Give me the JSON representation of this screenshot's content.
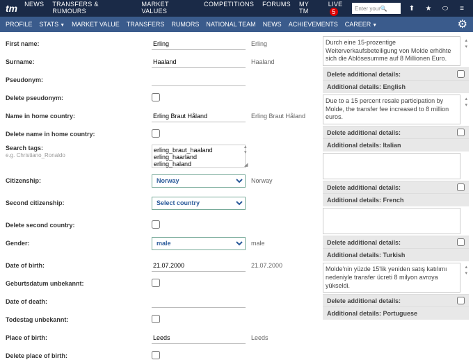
{
  "topnav": {
    "logo": "tm",
    "items": [
      "NEWS",
      "TRANSFERS & RUMOURS",
      "MARKET VALUES",
      "COMPETITIONS",
      "FORUMS",
      "MY TM",
      "LIVE"
    ],
    "live_count": "5",
    "search_placeholder": "Enter your"
  },
  "subnav": {
    "items": [
      "PROFILE",
      "STATS",
      "MARKET VALUE",
      "TRANSFERS",
      "RUMORS",
      "NATIONAL TEAM",
      "NEWS",
      "ACHIEVEMENTS",
      "CAREER"
    ]
  },
  "form": {
    "first_name": {
      "label": "First name:",
      "value": "Erling",
      "after": "Erling"
    },
    "surname": {
      "label": "Surname:",
      "value": "Haaland",
      "after": "Haaland"
    },
    "pseudonym": {
      "label": "Pseudonym:",
      "value": ""
    },
    "delete_pseudonym": {
      "label": "Delete pseudonym:"
    },
    "home_name": {
      "label": "Name in home country:",
      "value": "Erling Braut Håland",
      "after": "Erling Braut Håland"
    },
    "delete_home_name": {
      "label": "Delete name in home country:"
    },
    "search_tags": {
      "label": "Search tags:",
      "hint": "e.g. Christiano_Ronaldo",
      "value": "erling_braut_haaland\nerling_haarland\nerling_haland"
    },
    "citizenship": {
      "label": "Citizenship:",
      "value": "Norway",
      "after": "Norway"
    },
    "second_citizenship": {
      "label": "Second citizenship:",
      "value": "Select country"
    },
    "delete_second_country": {
      "label": "Delete second country:"
    },
    "gender": {
      "label": "Gender:",
      "value": "male",
      "after": "male"
    },
    "dob": {
      "label": "Date of birth:",
      "value": "21.07.2000",
      "after": "21.07.2000"
    },
    "dob_unknown": {
      "label": "Geburtsdatum unbekannt:"
    },
    "dod": {
      "label": "Date of death:",
      "value": ""
    },
    "dod_unknown": {
      "label": "Todestag unbekannt:"
    },
    "pob": {
      "label": "Place of birth:",
      "value": "Leeds",
      "after": "Leeds"
    },
    "delete_pob": {
      "label": "Delete place of birth:"
    }
  },
  "right": {
    "german_text": "Durch eine 15-prozentige Weiterverkaufsbeteiligung von Molde erhöhte sich die Ablösesumme auf 8 Millionen Euro.",
    "delete_label": "Delete additional details:",
    "english_head": "Additional details: English",
    "english_text": "Due to a 15 percent resale participation by Molde, the transfer fee increased to 8 million euros.",
    "italian_head": "Additional details: Italian",
    "french_head": "Additional details: French",
    "turkish_head": "Additional details: Turkish",
    "turkish_text": "Molde'nin yüzde 15'lik yeniden satış katılımı nedeniyle transfer ücreti 8 milyon avroya yükseldi.",
    "portuguese_head": "Additional details: Portuguese"
  }
}
